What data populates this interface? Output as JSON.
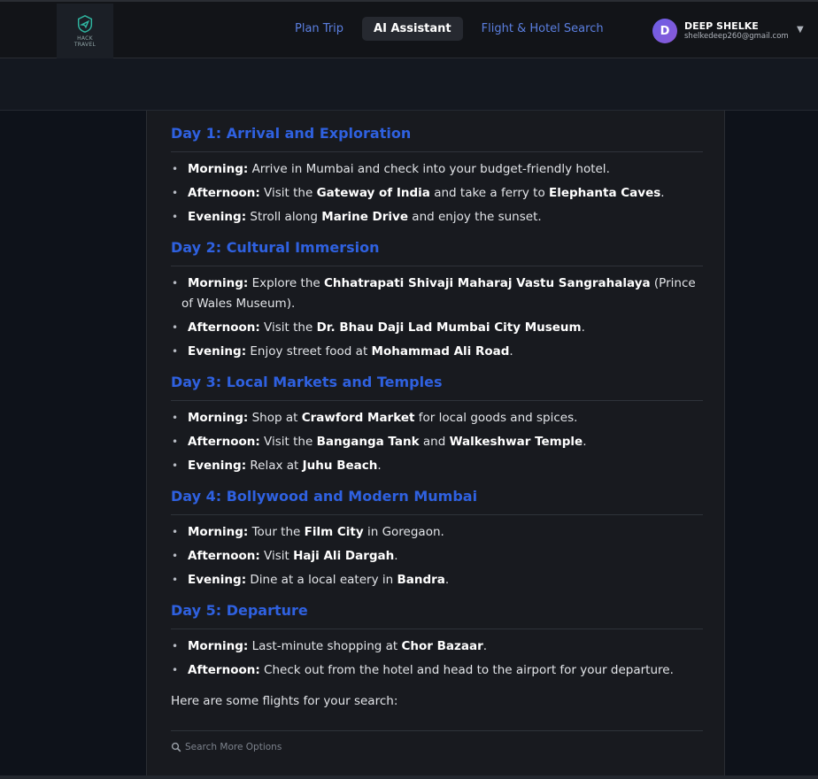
{
  "brand": {
    "logo_line1": "HACK",
    "logo_line2": "TRAVEL"
  },
  "nav": {
    "items": [
      {
        "label": "Plan Trip",
        "active": false
      },
      {
        "label": "AI Assistant",
        "active": true
      },
      {
        "label": "Flight & Hotel Search",
        "active": false
      }
    ]
  },
  "user": {
    "initial": "D",
    "name": "DEEP SHELKE",
    "email": "shelkedeep260@gmail.com",
    "caret": "▼"
  },
  "itinerary": {
    "days": [
      {
        "title": "Day 1: Arrival and Exploration",
        "activities": [
          [
            {
              "b": "Morning:"
            },
            {
              "t": " Arrive in Mumbai and check into your budget-friendly hotel."
            }
          ],
          [
            {
              "b": "Afternoon:"
            },
            {
              "t": " Visit the "
            },
            {
              "b": "Gateway of India"
            },
            {
              "t": " and take a ferry to "
            },
            {
              "b": "Elephanta Caves"
            },
            {
              "t": "."
            }
          ],
          [
            {
              "b": "Evening:"
            },
            {
              "t": " Stroll along "
            },
            {
              "b": "Marine Drive"
            },
            {
              "t": " and enjoy the sunset."
            }
          ]
        ]
      },
      {
        "title": "Day 2: Cultural Immersion",
        "activities": [
          [
            {
              "b": "Morning:"
            },
            {
              "t": " Explore the "
            },
            {
              "b": "Chhatrapati Shivaji Maharaj Vastu Sangrahalaya"
            },
            {
              "t": " (Prince of Wales Museum)."
            }
          ],
          [
            {
              "b": "Afternoon:"
            },
            {
              "t": " Visit the "
            },
            {
              "b": "Dr. Bhau Daji Lad Mumbai City Museum"
            },
            {
              "t": "."
            }
          ],
          [
            {
              "b": "Evening:"
            },
            {
              "t": " Enjoy street food at "
            },
            {
              "b": "Mohammad Ali Road"
            },
            {
              "t": "."
            }
          ]
        ]
      },
      {
        "title": "Day 3: Local Markets and Temples",
        "activities": [
          [
            {
              "b": "Morning:"
            },
            {
              "t": " Shop at "
            },
            {
              "b": "Crawford Market"
            },
            {
              "t": " for local goods and spices."
            }
          ],
          [
            {
              "b": "Afternoon:"
            },
            {
              "t": " Visit the "
            },
            {
              "b": "Banganga Tank"
            },
            {
              "t": " and "
            },
            {
              "b": "Walkeshwar Temple"
            },
            {
              "t": "."
            }
          ],
          [
            {
              "b": "Evening:"
            },
            {
              "t": " Relax at "
            },
            {
              "b": "Juhu Beach"
            },
            {
              "t": "."
            }
          ]
        ]
      },
      {
        "title": "Day 4: Bollywood and Modern Mumbai",
        "activities": [
          [
            {
              "b": "Morning:"
            },
            {
              "t": " Tour the "
            },
            {
              "b": "Film City"
            },
            {
              "t": " in Goregaon."
            }
          ],
          [
            {
              "b": "Afternoon:"
            },
            {
              "t": " Visit "
            },
            {
              "b": "Haji Ali Dargah"
            },
            {
              "t": "."
            }
          ],
          [
            {
              "b": "Evening:"
            },
            {
              "t": " Dine at a local eatery in "
            },
            {
              "b": "Bandra"
            },
            {
              "t": "."
            }
          ]
        ]
      },
      {
        "title": "Day 5: Departure",
        "activities": [
          [
            {
              "b": "Morning:"
            },
            {
              "t": " Last-minute shopping at "
            },
            {
              "b": "Chor Bazaar"
            },
            {
              "t": "."
            }
          ],
          [
            {
              "b": "Afternoon:"
            },
            {
              "t": " Check out from the hotel and head to the airport for your departure."
            }
          ]
        ]
      }
    ],
    "flights_intro": "Here are some flights for your search:",
    "search_more_label": "Search More Options"
  },
  "colors": {
    "accent": "#2f61e0",
    "nav_link": "#5b7fe0",
    "background": "#0f1218",
    "panel": "#181a1f"
  }
}
